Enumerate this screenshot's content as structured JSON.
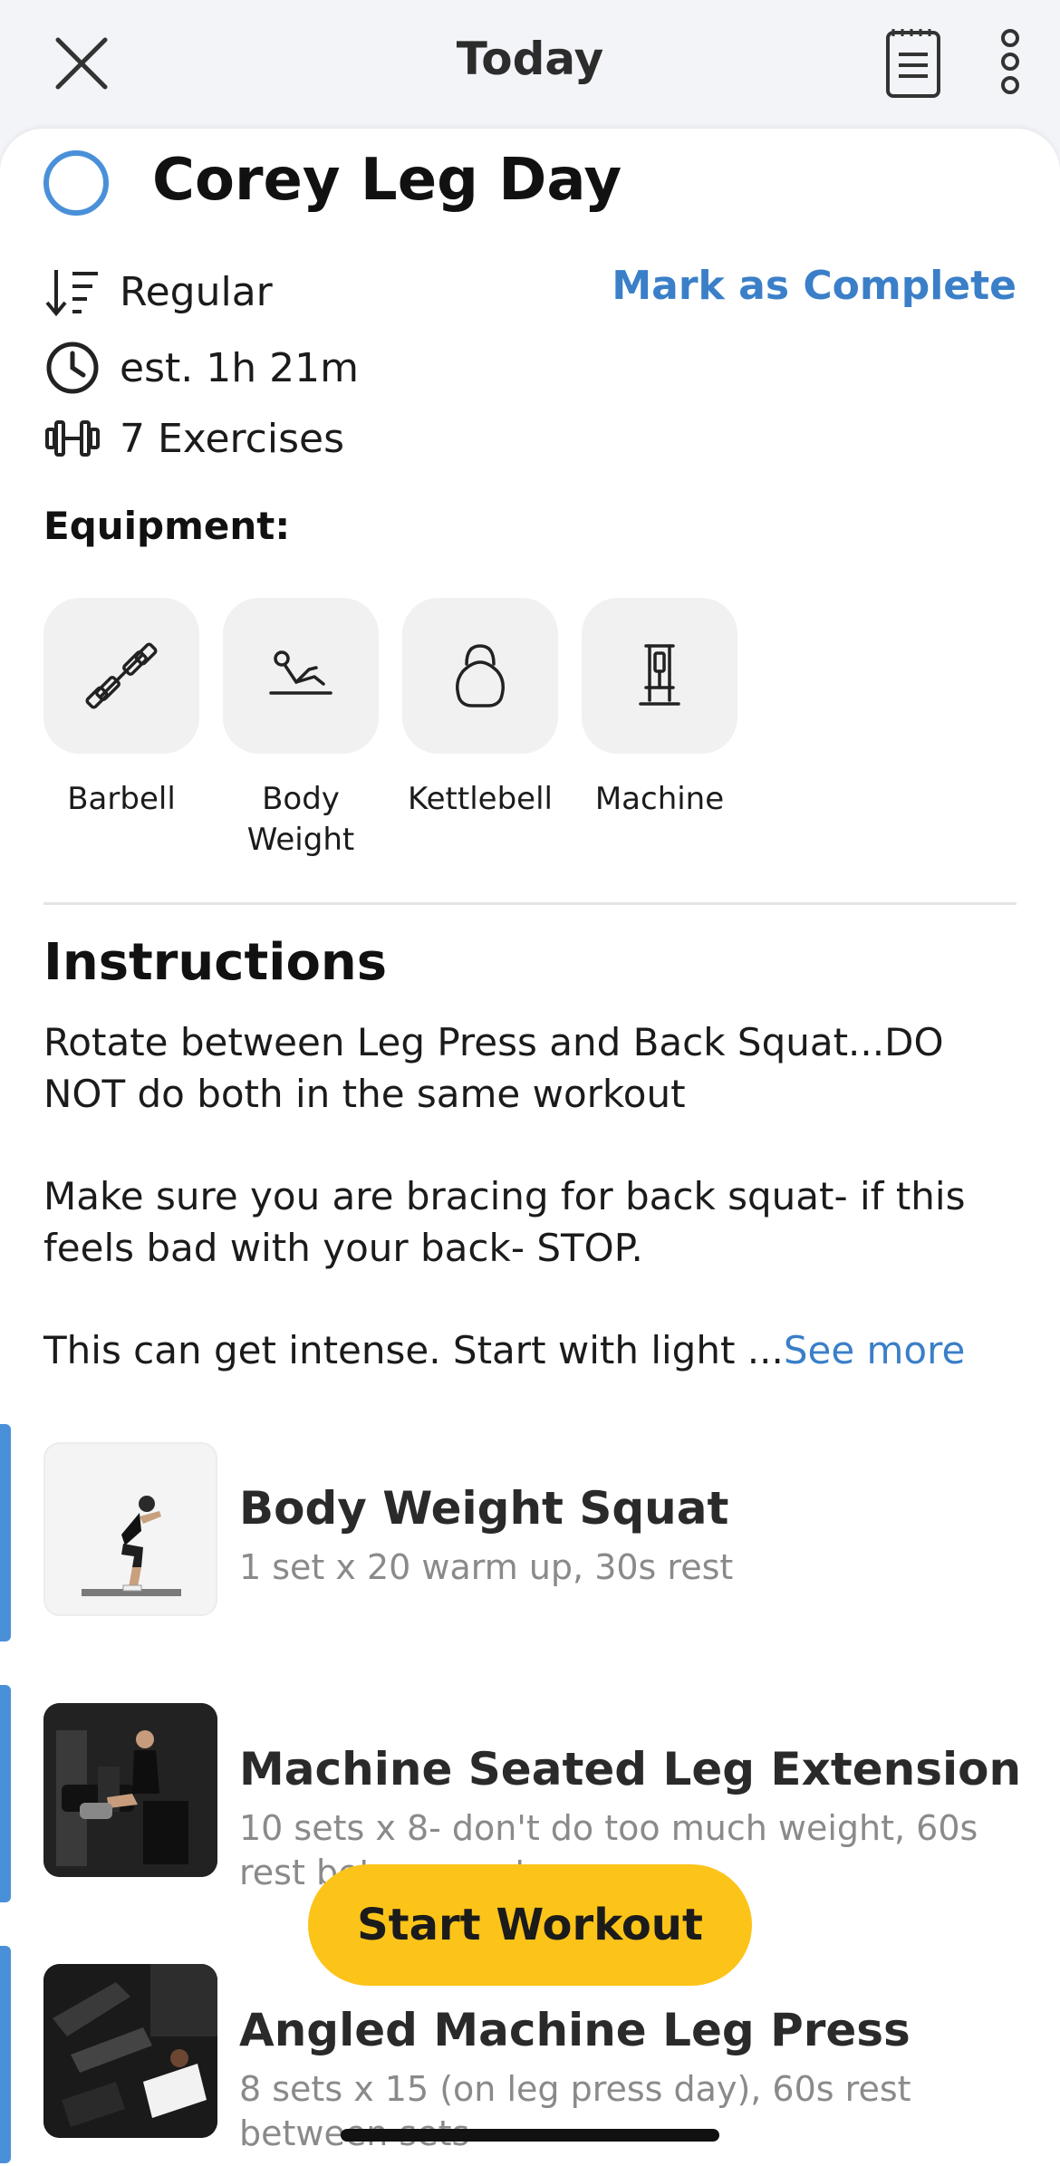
{
  "header": {
    "title": "Today"
  },
  "workout": {
    "title": "Corey Leg Day",
    "type": "Regular",
    "duration": "est. 1h 21m",
    "exercise_count": "7 Exercises",
    "mark_complete_label": "Mark as Complete"
  },
  "equipment": {
    "heading": "Equipment:",
    "items": [
      {
        "label": "Barbell",
        "icon": "barbell-icon"
      },
      {
        "label": "Body Weight",
        "icon": "body-weight-icon"
      },
      {
        "label": "Kettlebell",
        "icon": "kettlebell-icon"
      },
      {
        "label": "Machine",
        "icon": "machine-icon"
      }
    ]
  },
  "instructions": {
    "heading": "Instructions",
    "paragraphs": [
      "Rotate between Leg Press and Back Squat...DO NOT do both in the same workout",
      "Make sure you are bracing for back squat- if this feels bad with your back- STOP.",
      "This can get intense. Start with light ..."
    ],
    "see_more": "See more"
  },
  "exercises": [
    {
      "name": "Body Weight Squat",
      "detail": "1 set x 20 warm up, 30s rest"
    },
    {
      "name": "Machine Seated Leg Extension",
      "detail": "10 sets x 8- don't do too much weight, 60s rest between sets"
    },
    {
      "name": "Angled Machine Leg Press",
      "detail": "8 sets x 15 (on leg press day), 60s rest between sets"
    }
  ],
  "start_button": {
    "label": "Start Workout"
  },
  "colors": {
    "accent_blue": "#4a90d9",
    "link_blue": "#3a7fc8",
    "start_yellow": "#fcc419"
  }
}
